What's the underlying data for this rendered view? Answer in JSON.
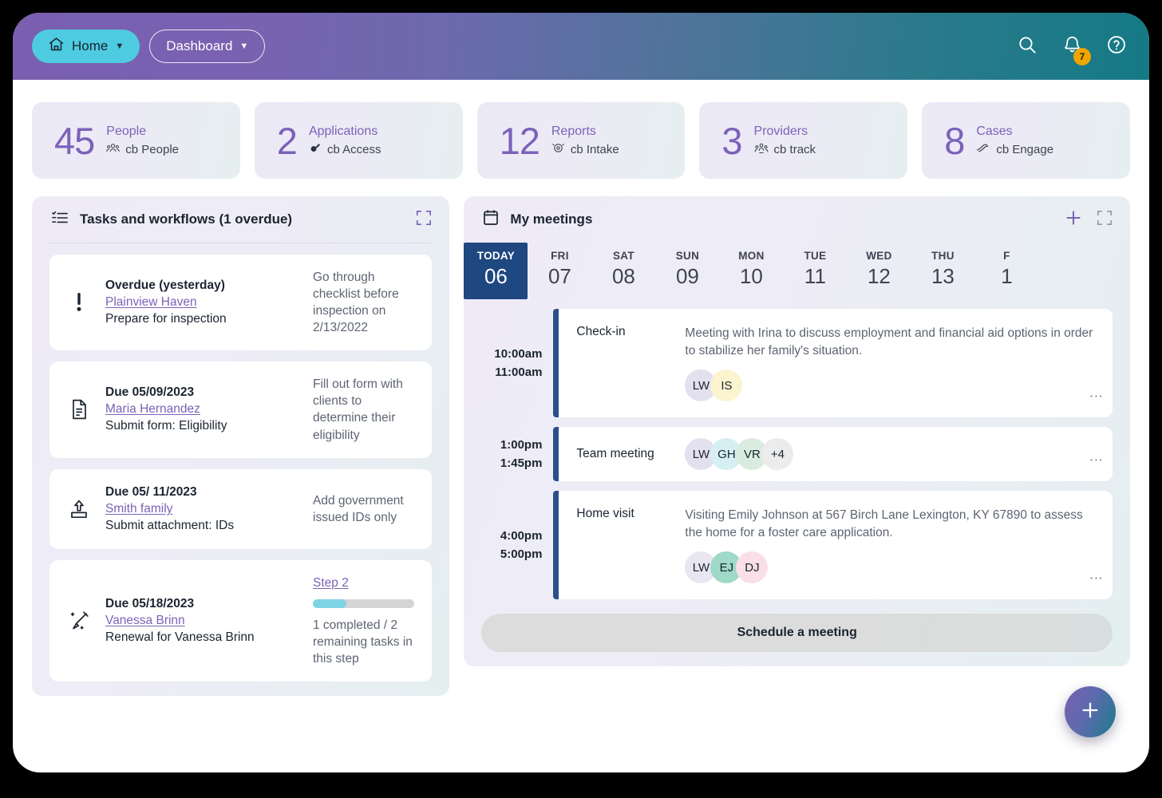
{
  "topbar": {
    "home_label": "Home",
    "dashboard_label": "Dashboard",
    "notification_count": "7"
  },
  "stats": [
    {
      "value": "45",
      "label": "People",
      "source": "cb People",
      "icon": "people-icon"
    },
    {
      "value": "2",
      "label": "Applications",
      "source": "cb Access",
      "icon": "access-icon"
    },
    {
      "value": "12",
      "label": "Reports",
      "source": "cb Intake",
      "icon": "intake-icon"
    },
    {
      "value": "3",
      "label": "Providers",
      "source": "cb track",
      "icon": "track-icon"
    },
    {
      "value": "8",
      "label": "Cases",
      "source": "cb Engage",
      "icon": "engage-icon"
    }
  ],
  "tasks_panel": {
    "title": "Tasks and workflows (1 overdue)",
    "items": [
      {
        "icon": "alert-icon",
        "due": "Overdue (yesterday)",
        "link": "Plainview Haven",
        "name": "Prepare for inspection",
        "desc": "Go through checklist before inspection on 2/13/2022"
      },
      {
        "icon": "document-icon",
        "due": "Due 05/09/2023",
        "link": "Maria Hernandez",
        "name": "Submit form: Eligibility",
        "desc": "Fill out form with clients to determine their eligibility"
      },
      {
        "icon": "upload-icon",
        "due": "Due 05/ 11/2023",
        "link": "Smith family",
        "name": "Submit attachment: IDs",
        "desc": "Add government issued IDs only"
      },
      {
        "icon": "wand-icon",
        "due": "Due 05/18/2023",
        "link": "Vanessa Brinn",
        "name": "Renewal for Vanessa Brinn",
        "step_label": "Step 2",
        "progress_percent": 33,
        "desc": "1 completed / 2 remaining tasks in this step"
      }
    ]
  },
  "meetings_panel": {
    "title": "My meetings",
    "days": [
      {
        "dow": "TODAY",
        "num": "06",
        "today": true
      },
      {
        "dow": "FRI",
        "num": "07",
        "today": false
      },
      {
        "dow": "SAT",
        "num": "08",
        "today": false
      },
      {
        "dow": "SUN",
        "num": "09",
        "today": false
      },
      {
        "dow": "MON",
        "num": "10",
        "today": false
      },
      {
        "dow": "TUE",
        "num": "11",
        "today": false
      },
      {
        "dow": "WED",
        "num": "12",
        "today": false
      },
      {
        "dow": "THU",
        "num": "13",
        "today": false
      },
      {
        "dow": "F",
        "num": "1",
        "today": false
      }
    ],
    "meetings": [
      {
        "start": "10:00am",
        "end": "11:00am",
        "kind": "Check-in",
        "desc": "Meeting with Irina to discuss employment and financial aid options in order to stabilize her family's situation.",
        "avatars": [
          {
            "initials": "LW",
            "color": "#e3e0ef"
          },
          {
            "initials": "IS",
            "color": "#fbf4cf"
          }
        ]
      },
      {
        "start": "1:00pm",
        "end": "1:45pm",
        "kind": "Team meeting",
        "desc": "",
        "avatars": [
          {
            "initials": "LW",
            "color": "#e3e0ef"
          },
          {
            "initials": "GH",
            "color": "#d5eff3"
          },
          {
            "initials": "VR",
            "color": "#d9ecdf"
          },
          {
            "initials": "+4",
            "color": "#ececec"
          }
        ]
      },
      {
        "start": "4:00pm",
        "end": "5:00pm",
        "kind": "Home visit",
        "desc": "Visiting Emily Johnson at 567 Birch Lane Lexington, KY 67890 to assess the home for a foster care application.",
        "avatars": [
          {
            "initials": "LW",
            "color": "#e8e6f1"
          },
          {
            "initials": "EJ",
            "color": "#9fd9c7"
          },
          {
            "initials": "DJ",
            "color": "#fadfe6"
          }
        ]
      }
    ],
    "schedule_label": "Schedule a meeting"
  },
  "colors": {
    "accent_purple": "#7b62b8",
    "accent_teal": "#4ecbe0",
    "today_blue": "#1f4780",
    "badge_amber": "#f0a500"
  }
}
